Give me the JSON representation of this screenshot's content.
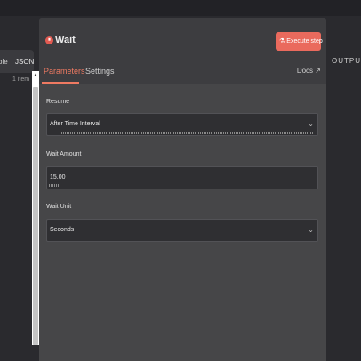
{
  "left": {
    "mode_table": "ble",
    "mode_json": "JSON",
    "item_count": "1 item"
  },
  "node": {
    "title": "Wait",
    "execute_label": "Execute step"
  },
  "tabs": {
    "parameters": "Parameters",
    "settings": "Settings",
    "docs": "Docs"
  },
  "fields": {
    "resume_label": "Resume",
    "resume_value": "After Time Interval",
    "wait_amount_label": "Wait Amount",
    "wait_amount_value": "15.00",
    "wait_unit_label": "Wait Unit",
    "wait_unit_value": "Seconds"
  },
  "output": {
    "label": "OUTPUT"
  },
  "colors": {
    "accent": "#ef7a62",
    "execute_button": "#ea6a5d",
    "panel": "#464648"
  },
  "icons": [
    "wait-node-icon",
    "flask-icon",
    "external-link-icon",
    "chevron-down-icon",
    "scroll-up-arrow-icon"
  ]
}
